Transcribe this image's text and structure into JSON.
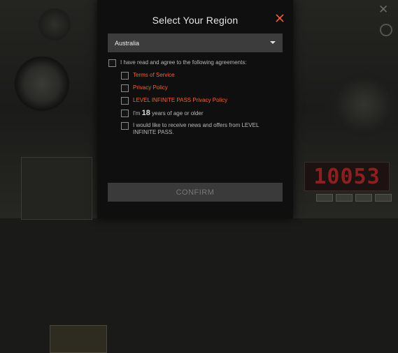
{
  "dialog": {
    "title": "Select Your Region",
    "region_selected": "Australia",
    "agree_all": "I have read and agree to the following agreements:",
    "terms_label": "Terms of Service",
    "privacy_label": "Privacy Policy",
    "pass_privacy_label": "LEVEL INFINITE PASS Privacy Policy",
    "age_prefix": "I'm",
    "age_value": "18",
    "age_suffix": "years of age or older",
    "newsletter_label": "I would like to receive news and offers from LEVEL INFINITE PASS.",
    "confirm_label": "CONFIRM"
  },
  "background": {
    "timer_display": "10053"
  },
  "colors": {
    "link": "#f0613a",
    "close": "#f0613a",
    "dialog_bg": "#0f0f0f"
  },
  "icons": {
    "close": "close-icon",
    "dropdown": "chevron-down-icon"
  }
}
